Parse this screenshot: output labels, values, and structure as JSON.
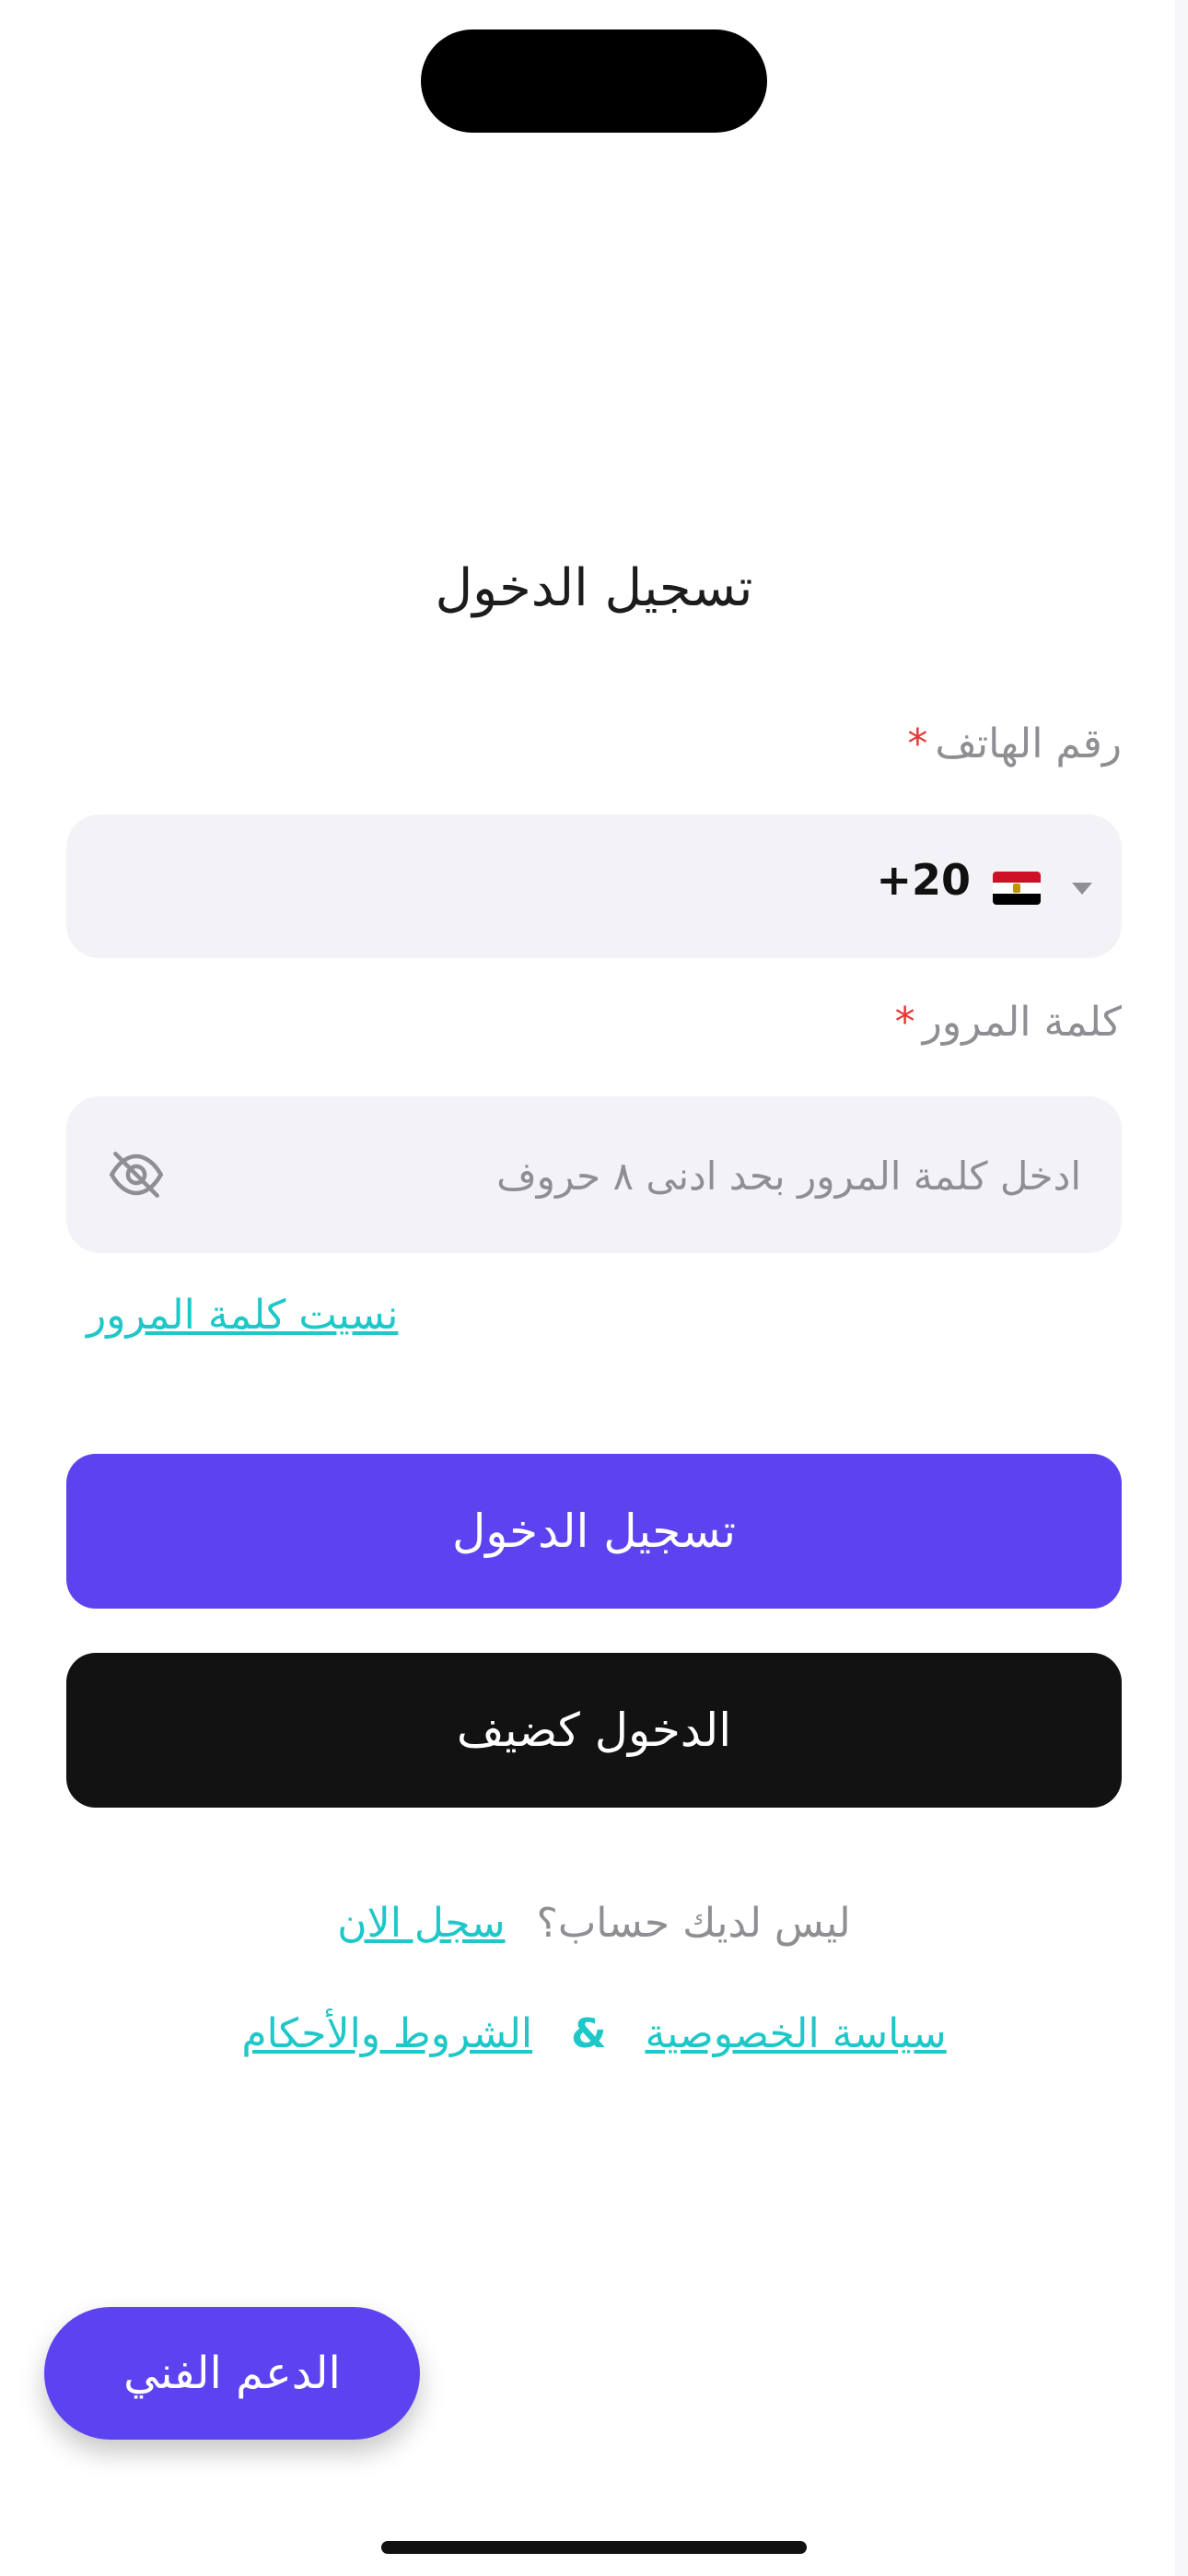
{
  "title": "تسجيل الدخول",
  "phone": {
    "label": "رقم الهاتف",
    "required_mark": "*",
    "dial_code": "+20",
    "country_flag": "egypt-flag-icon"
  },
  "password": {
    "label": "كلمة المرور",
    "required_mark": "*",
    "value": "",
    "placeholder": "ادخل كلمة المرور بحد ادنى ٨ حروف",
    "toggle_icon": "eye-off-icon"
  },
  "forgot_password": "نسيت كلمة المرور",
  "buttons": {
    "login": "تسجيل الدخول",
    "guest": "الدخول كضيف"
  },
  "signup": {
    "question": "ليس لديك حساب؟",
    "link": "سجل الان"
  },
  "legal": {
    "privacy": "سياسة الخصوصية",
    "separator": "&",
    "terms": "الشروط والأحكام"
  },
  "support_button": "الدعم الفني",
  "colors": {
    "primary": "#5d43f0",
    "dark_button": "#121212",
    "link": "#1ec7c8",
    "required": "#e53935",
    "field_bg": "#f3f3f7",
    "muted_text": "#8e8e93"
  }
}
